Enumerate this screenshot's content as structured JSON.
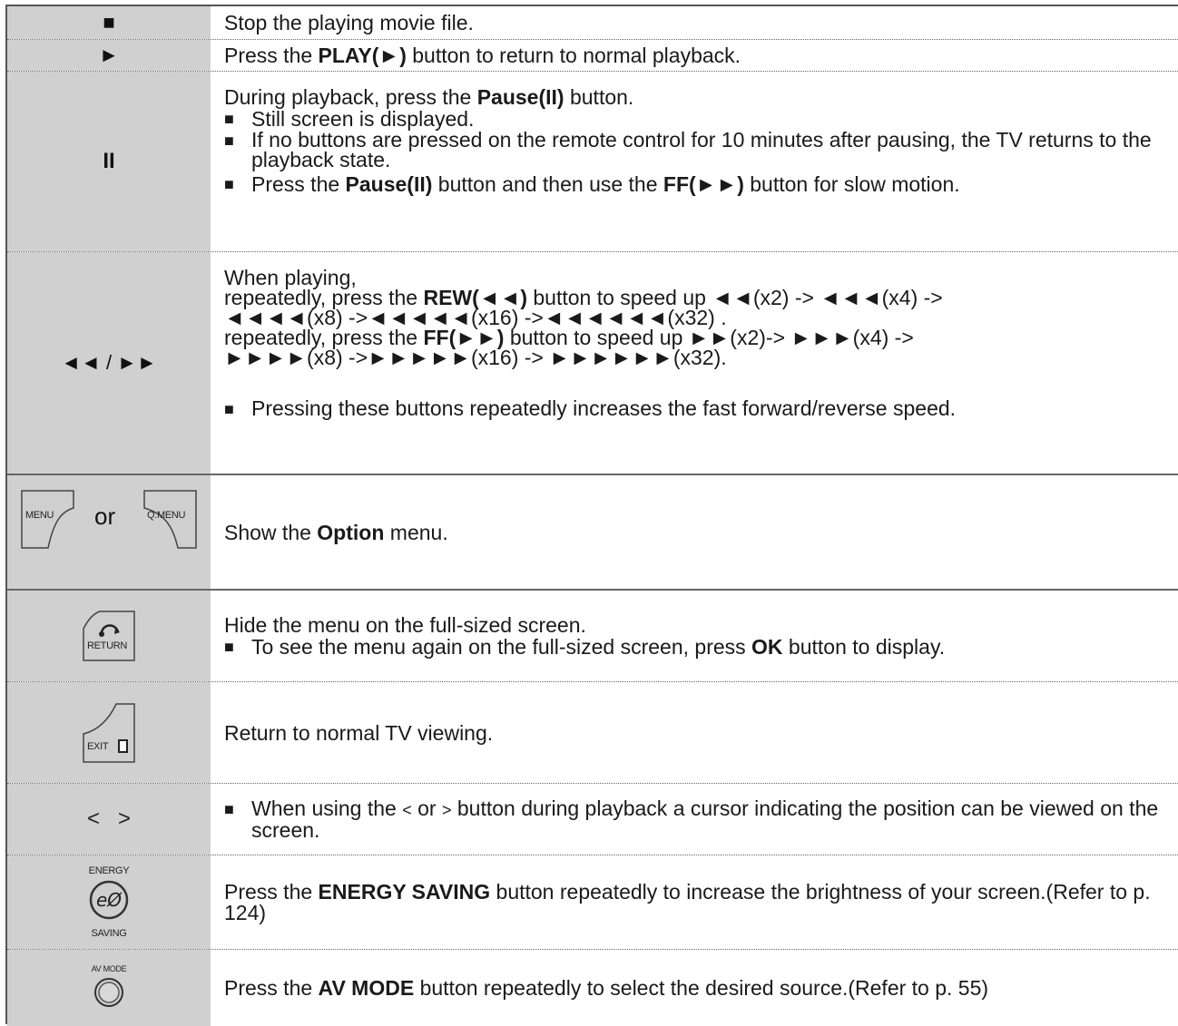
{
  "rows": {
    "stop": {
      "icon": "■",
      "text": "Stop the playing movie file."
    },
    "play": {
      "icon": "►",
      "pre": "Press the ",
      "bold": "PLAY(►)",
      "post": " button to return to normal playback."
    },
    "pause": {
      "icon": "II",
      "l1_pre": "During playback, press the ",
      "l1_bold": "Pause(II)",
      "l1_post": " button.",
      "b1": "Still screen is displayed.",
      "b2": "If no buttons are pressed on the remote control for 10 minutes after pausing, the TV returns to the playback state.",
      "b3_pre": "Press the ",
      "b3_bold1": "Pause(II)",
      "b3_mid": " button and then use the ",
      "b3_bold2": "FF(►►)",
      "b3_post": " button for slow motion.",
      "bullet": "■"
    },
    "speed": {
      "icon": "◄◄ / ►►",
      "l1": "When playing,",
      "l2_pre": "repeatedly, press the ",
      "l2_bold": "REW(◄◄)",
      "l2_post": " button to speed up ◄◄(x2) -> ◄◄◄(x4) ->",
      "l3": "◄◄◄◄(x8) ->◄◄◄◄◄(x16) ->◄◄◄◄◄◄(x32) .",
      "l4_pre": "repeatedly, press the ",
      "l4_bold": "FF(►►)",
      "l4_post": " button to speed up ►►(x2)-> ►►►(x4) ->",
      "l5": "►►►►(x8) ->►►►►►(x16) -> ►►►►►►(x32).",
      "b1": "Pressing these buttons repeatedly increases the fast forward/reverse speed.",
      "bullet": "■"
    },
    "option": {
      "btn1": "MENU",
      "or": "or",
      "btn2": "Q.MENU",
      "pre": "Show the ",
      "bold": "Option",
      "post": " menu."
    },
    "return": {
      "btn": "RETURN",
      "l1": "Hide the menu on the full-sized screen.",
      "b1_pre": "To see the menu again on the full-sized screen, press ",
      "b1_bold": "OK",
      "b1_post": " button to display.",
      "bullet": "■"
    },
    "exit": {
      "btn": "EXIT",
      "text": "Return to normal TV viewing."
    },
    "cursor": {
      "icon": "<   >",
      "b1_pre": "When using the ",
      "b1_lt": "<",
      "b1_mid": " or ",
      "b1_gt": ">",
      "b1_post": " button during playback a cursor indicating the position can be viewed on the screen.",
      "bullet": "■"
    },
    "energy": {
      "top": "ENERGY",
      "bottom": "SAVING",
      "pre": "Press the ",
      "bold": "ENERGY SAVING",
      "post": " button repeatedly to increase the brightness of your screen.(Refer to p. 124)"
    },
    "avmode": {
      "top": "AV MODE",
      "pre": "Press the ",
      "bold": "AV MODE",
      "post": " button repeatedly to select the desired source.(Refer to p. 55)"
    }
  }
}
